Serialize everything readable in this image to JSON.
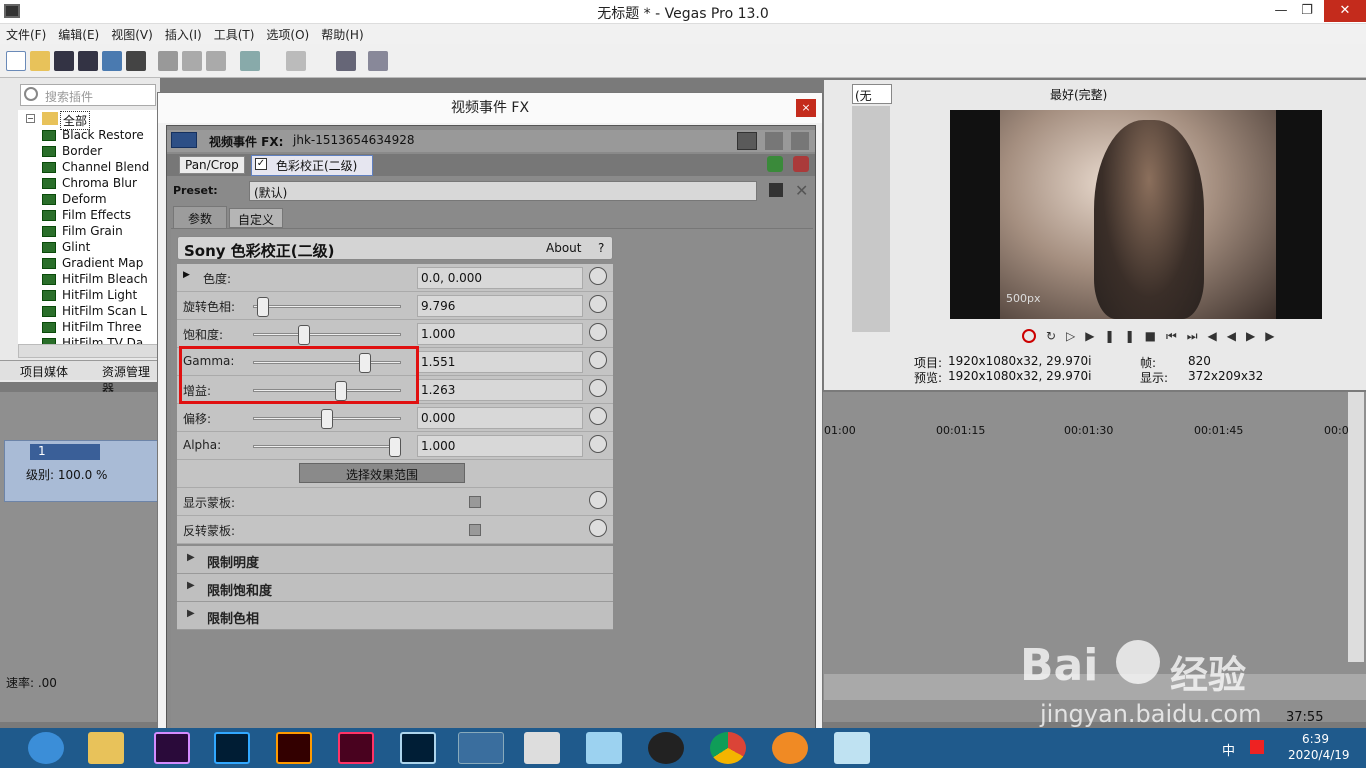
{
  "app": {
    "title": "无标题 * - Vegas Pro 13.0"
  },
  "menu": [
    "文件(F)",
    "编辑(E)",
    "视图(V)",
    "插入(I)",
    "工具(T)",
    "选项(O)",
    "帮助(H)"
  ],
  "explorer": {
    "search_placeholder": "搜索插件",
    "root": "全部",
    "plugins": [
      "Black Restore",
      "Border",
      "Channel Blend",
      "Chroma Blur",
      "Deform",
      "Film Effects",
      "Film Grain",
      "Glint",
      "Gradient Map",
      "HitFilm Bleach",
      "HitFilm Light",
      "HitFilm Scan L",
      "HitFilm Three",
      "HitFilm TV Da"
    ],
    "tabs": [
      "项目媒体",
      "资源管理器"
    ]
  },
  "track": {
    "number": "1",
    "level": "级别: 100.0 %",
    "rate": "速率: .00"
  },
  "dialog": {
    "title": "视频事件 FX",
    "close": "×",
    "event_label": "视频事件 FX:",
    "event_name": "jhk-1513654634928",
    "chain": [
      "Pan/Crop",
      "色彩校正(二级)"
    ],
    "preset_label": "Preset:",
    "preset_value": "(默认)",
    "tabs": [
      "参数",
      "自定义"
    ],
    "plugin_title": "Sony 色彩校正(二级)",
    "about": "About",
    "help": "?",
    "params": [
      {
        "label": "色度:",
        "value": "0.0, 0.000",
        "slider": null
      },
      {
        "label": "旋转色相:",
        "value": "9.796",
        "slider": 0.03
      },
      {
        "label": "饱和度:",
        "value": "1.000",
        "slider": 0.33
      },
      {
        "label": "Gamma:",
        "value": "1.551",
        "slider": 0.78
      },
      {
        "label": "增益:",
        "value": "1.263",
        "slider": 0.6
      },
      {
        "label": "偏移:",
        "value": "0.000",
        "slider": 0.5
      },
      {
        "label": "Alpha:",
        "value": "1.000",
        "slider": 1.0
      }
    ],
    "select_range_button": "选择效果范围",
    "checks": [
      {
        "label": "显示蒙板:"
      },
      {
        "label": "反转蒙板:"
      }
    ],
    "sections": [
      "限制明度",
      "限制饱和度",
      "限制色相"
    ]
  },
  "preview": {
    "dropdown": "(无",
    "quality": "最好(完整)",
    "project_label": "项目:",
    "project_value": "1920x1080x32, 29.970i",
    "preview_label": "预览:",
    "preview_value": "1920x1080x32, 29.970i",
    "frame_label": "帧:",
    "frame_value": "820",
    "display_label": "显示:",
    "display_value": "372x209x32",
    "watermark": "500px"
  },
  "timeline": {
    "ticks": [
      "01:00",
      "00:01:15",
      "00:01:30",
      "00:01:45",
      "00:0"
    ],
    "time": "37:55"
  },
  "watermark": {
    "brand": "Bai",
    "brand2": "经验",
    "url": "jingyan.baidu.com"
  },
  "tray": {
    "time": "6:39",
    "date": "2020/4/19",
    "ime": "中"
  },
  "colors": {
    "highlight": "#e01010",
    "accent": "#1f5a8c"
  }
}
